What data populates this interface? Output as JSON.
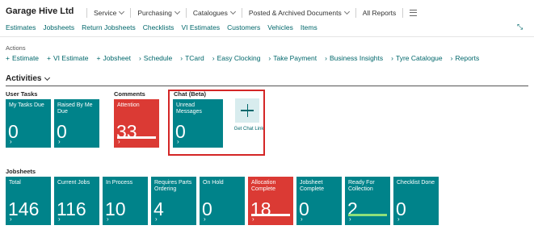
{
  "header": {
    "brand": "Garage Hive Ltd",
    "menu": [
      {
        "label": "Service",
        "has_dropdown": true
      },
      {
        "label": "Purchasing",
        "has_dropdown": true
      },
      {
        "label": "Catalogues",
        "has_dropdown": true
      },
      {
        "label": "Posted & Archived Documents",
        "has_dropdown": true
      },
      {
        "label": "All Reports",
        "has_dropdown": false
      }
    ]
  },
  "navlinks": [
    "Estimates",
    "Jobsheets",
    "Return Jobsheets",
    "Checklists",
    "VI Estimates",
    "Customers",
    "Vehicles",
    "Items"
  ],
  "actions": {
    "label": "Actions",
    "items": [
      {
        "label": "Estimate",
        "icon": "plus"
      },
      {
        "label": "VI Estimate",
        "icon": "plus"
      },
      {
        "label": "Jobsheet",
        "icon": "plus"
      },
      {
        "label": "Schedule",
        "icon": "chevron"
      },
      {
        "label": "TCard",
        "icon": "chevron"
      },
      {
        "label": "Easy Clocking",
        "icon": "chevron"
      },
      {
        "label": "Take Payment",
        "icon": "chevron"
      },
      {
        "label": "Business Insights",
        "icon": "chevron"
      },
      {
        "label": "Tyre Catalogue",
        "icon": "chevron"
      },
      {
        "label": "Reports",
        "icon": "chevron"
      }
    ]
  },
  "activities": {
    "title": "Activities",
    "user_tasks": {
      "title": "User Tasks",
      "tiles": [
        {
          "label": "My Tasks Due",
          "value": "0"
        },
        {
          "label": "Raised By Me Due",
          "value": "0"
        }
      ]
    },
    "comments": {
      "title": "Comments",
      "tiles": [
        {
          "label": "Attention",
          "value": "33",
          "color": "#db3a34",
          "bar_color": "#ffffff"
        }
      ]
    },
    "chat": {
      "title": "Chat (Beta)",
      "tiles": [
        {
          "label": "Unread Messages",
          "value": "0"
        }
      ],
      "link_label": "Get Chat Link"
    },
    "jobsheets": {
      "title": "Jobsheets",
      "tiles": [
        {
          "label": "Total",
          "value": "146"
        },
        {
          "label": "Current Jobs",
          "value": "116"
        },
        {
          "label": "In Process",
          "value": "10"
        },
        {
          "label": "Requires Parts Ordering",
          "value": "4"
        },
        {
          "label": "On Hold",
          "value": "0"
        },
        {
          "label": "Allocation Complete",
          "value": "18",
          "color": "#db3a34",
          "bar_color": "#ffffff"
        },
        {
          "label": "Jobsheet Complete",
          "value": "0"
        },
        {
          "label": "Ready For Collection",
          "value": "2",
          "bar_color": "#8fe07a"
        },
        {
          "label": "Checklist Done",
          "value": "0"
        }
      ]
    }
  },
  "icons": {
    "chevron": "›",
    "plus": "+",
    "arrow": "›",
    "expand": "⤡"
  },
  "colors": {
    "teal": "#00838a",
    "red": "#db3a34",
    "link": "#00676b",
    "highlight": "#d42626"
  }
}
